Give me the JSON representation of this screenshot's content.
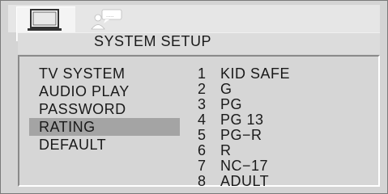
{
  "title": "SYSTEM SETUP",
  "icons": {
    "selected_tab": "monitor-icon",
    "other_tab": "person-speech-icon"
  },
  "menu": {
    "items": [
      "TV SYSTEM",
      "AUDIO PLAY",
      "PASSWORD",
      "RATING",
      "DEFAULT"
    ],
    "selected": "RATING"
  },
  "ratings": [
    {
      "num": "1",
      "label": "KID SAFE"
    },
    {
      "num": "2",
      "label": "G"
    },
    {
      "num": "3",
      "label": "PG"
    },
    {
      "num": "4",
      "label": "PG 13"
    },
    {
      "num": "5",
      "label": "PG−R"
    },
    {
      "num": "6",
      "label": "R"
    },
    {
      "num": "7",
      "label": "NC−17"
    },
    {
      "num": "8",
      "label": "ADULT"
    }
  ],
  "colors": {
    "background": "#d4d4d4",
    "selection": "#a4a4a4",
    "text": "#1a1a1a"
  }
}
